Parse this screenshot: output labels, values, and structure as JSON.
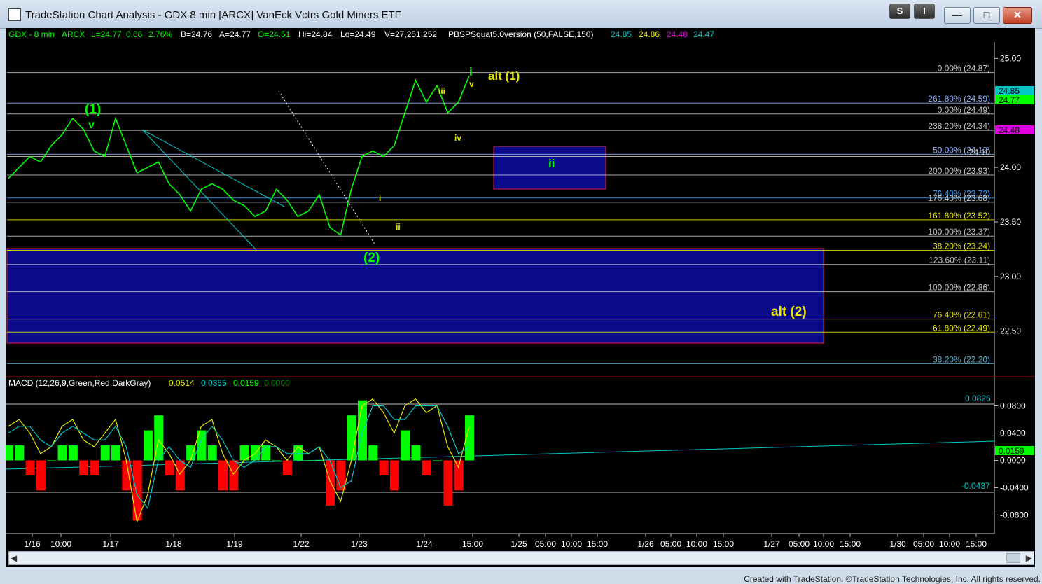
{
  "window": {
    "title": "TradeStation Chart Analysis - GDX 8 min [ARCX] VanEck Vctrs Gold Miners ETF",
    "btn_s": "S",
    "btn_i": "I",
    "footer": "Created with TradeStation. ©TradeStation Technologies, Inc. All rights reserved."
  },
  "header": {
    "symbol": "GDX - 8 min",
    "exchange": "ARCX",
    "last": "L=24.77",
    "change": "0.66",
    "pct": "2.76%",
    "bid": "B=24.76",
    "ask": "A=24.77",
    "open": "O=24.51",
    "high": "Hi=24.84",
    "low": "Lo=24.49",
    "volume": "V=27,251,252",
    "indicator": "PBSPSquat5.0version (50,FALSE,150)",
    "ind_values": [
      "24.85",
      "24.86",
      "24.48",
      "24.47"
    ]
  },
  "macd_header": {
    "name": "MACD (12,26,9,Green,Red,DarkGray)",
    "values": [
      "0.0514",
      "0.0355",
      "0.0159",
      "0.0000"
    ]
  },
  "colors": {
    "cyan": "#00c8c8",
    "yellow": "#e8e800",
    "magenta": "#e000e0",
    "green": "#00ff00",
    "red": "#ff0000",
    "zone": "#0a0a8a",
    "zoneBorder": "#e0203a"
  },
  "chart_data": {
    "type": "line",
    "price_axis": {
      "ticks": [
        "25.00",
        "24.00",
        "23.50",
        "23.00",
        "22.50"
      ],
      "ylim": [
        22.1,
        25.15
      ]
    },
    "price_badges": [
      "24.85",
      "24.77",
      "24.48"
    ],
    "x_ticks": [
      "1/16",
      "10:00",
      "1/17",
      "1/18",
      "1/19",
      "1/22",
      "1/23",
      "1/24",
      "15:00",
      "1/25",
      "05:00",
      "10:00",
      "15:00",
      "1/26",
      "05:00",
      "10:00",
      "15:00",
      "1/27",
      "05:00",
      "10:00",
      "15:00",
      "1/30",
      "05:00",
      "10:00",
      "15:00"
    ],
    "fib_labels": [
      {
        "text": "0.00% (24.87)",
        "price": 24.87,
        "color": "#c8c8c8"
      },
      {
        "text": "261.80% (24.59)",
        "price": 24.59,
        "color": "#8fb4ff"
      },
      {
        "text": "0.00% (24.49)",
        "price": 24.49,
        "color": "#c8c8c8"
      },
      {
        "text": "238.20% (24.34)",
        "price": 24.34,
        "color": "#c8c8c8"
      },
      {
        "text": "50.00% (24.12)",
        "price": 24.12,
        "color": "#8fb4ff"
      },
      {
        "text": "24.10",
        "price": 24.1,
        "color": "#c8c8c8"
      },
      {
        "text": "200.00% (23.93)",
        "price": 23.93,
        "color": "#c8c8c8"
      },
      {
        "text": "76.40% (23.72)",
        "price": 23.72,
        "color": "#3aa0ff"
      },
      {
        "text": "176.40% (23.68)",
        "price": 23.68,
        "color": "#c8c8c8"
      },
      {
        "text": "161.80% (23.52)",
        "price": 23.52,
        "color": "#e8e800"
      },
      {
        "text": "100.00% (23.37)",
        "price": 23.37,
        "color": "#c8c8c8"
      },
      {
        "text": "38.20% (23.24)",
        "price": 23.24,
        "color": "#e8e800"
      },
      {
        "text": "123.60% (23.11)",
        "price": 23.11,
        "color": "#c8c8c8"
      },
      {
        "text": "100.00% (22.86)",
        "price": 22.86,
        "color": "#c8c8c8"
      },
      {
        "text": "76.40% (22.61)",
        "price": 22.61,
        "color": "#e8e800"
      },
      {
        "text": "61.80% (22.49)",
        "price": 22.49,
        "color": "#e8e800"
      },
      {
        "text": "38.20% (22.20)",
        "price": 22.2,
        "color": "#5fb4d4"
      }
    ],
    "wave_labels": [
      {
        "text": "(1)",
        "color": "#00ff00"
      },
      {
        "text": "v",
        "color": "#00ff00"
      },
      {
        "text": "(2)",
        "color": "#00ff00"
      },
      {
        "text": "i",
        "color": "#e8e800"
      },
      {
        "text": "ii",
        "color": "#e8e800"
      },
      {
        "text": "iii",
        "color": "#e8e800"
      },
      {
        "text": "iv",
        "color": "#e8e800"
      },
      {
        "text": "v",
        "color": "#e8e800"
      },
      {
        "text": "i",
        "color": "#00ff00"
      },
      {
        "text": "alt (1)",
        "color": "#e8e800"
      },
      {
        "text": "ii",
        "color": "#00ff00"
      },
      {
        "text": "alt (2)",
        "color": "#e8e800"
      }
    ],
    "series": [
      {
        "name": "GDX",
        "values": [
          23.9,
          24.0,
          24.1,
          24.05,
          24.2,
          24.3,
          24.45,
          24.35,
          24.15,
          24.1,
          24.45,
          24.2,
          23.95,
          24.0,
          24.05,
          23.85,
          23.75,
          23.6,
          23.8,
          23.85,
          23.8,
          23.7,
          23.65,
          23.55,
          23.6,
          23.8,
          23.7,
          23.55,
          23.6,
          23.75,
          23.45,
          23.38,
          23.8,
          24.1,
          24.15,
          24.1,
          24.2,
          24.5,
          24.8,
          24.6,
          24.75,
          24.5,
          24.6,
          24.84
        ]
      }
    ],
    "macd_axis": {
      "ticks": [
        "0.0800",
        "0.0400",
        "0.0000",
        "-0.0400",
        "-0.0800"
      ],
      "ylim": [
        -0.1,
        0.1
      ]
    },
    "macd_badges": [
      "0.0826",
      "0.0159",
      "-0.0437"
    ],
    "macd_series": [
      {
        "name": "MACD",
        "values": [
          0.05,
          0.06,
          0.04,
          0.01,
          0.02,
          0.05,
          0.06,
          0.03,
          0.02,
          0.04,
          0.06,
          0.0,
          -0.09,
          -0.05,
          0.03,
          0.01,
          -0.02,
          0.0,
          0.05,
          0.06,
          0.01,
          -0.02,
          0.0,
          0.01,
          0.03,
          0.02,
          0.0,
          0.02,
          0.01,
          0.02,
          -0.03,
          -0.06,
          0.0,
          0.08,
          0.09,
          0.07,
          0.04,
          0.08,
          0.09,
          0.07,
          0.08,
          0.02,
          -0.01,
          0.05
        ]
      },
      {
        "name": "Signal",
        "values": [
          0.04,
          0.05,
          0.05,
          0.03,
          0.02,
          0.04,
          0.05,
          0.04,
          0.03,
          0.03,
          0.05,
          0.02,
          -0.05,
          -0.07,
          0.0,
          0.02,
          0.0,
          -0.01,
          0.03,
          0.05,
          0.03,
          0.0,
          -0.01,
          0.0,
          0.02,
          0.02,
          0.01,
          0.01,
          0.01,
          0.02,
          0.0,
          -0.04,
          -0.03,
          0.04,
          0.08,
          0.08,
          0.06,
          0.06,
          0.08,
          0.08,
          0.08,
          0.05,
          0.01,
          0.02
        ]
      }
    ]
  }
}
